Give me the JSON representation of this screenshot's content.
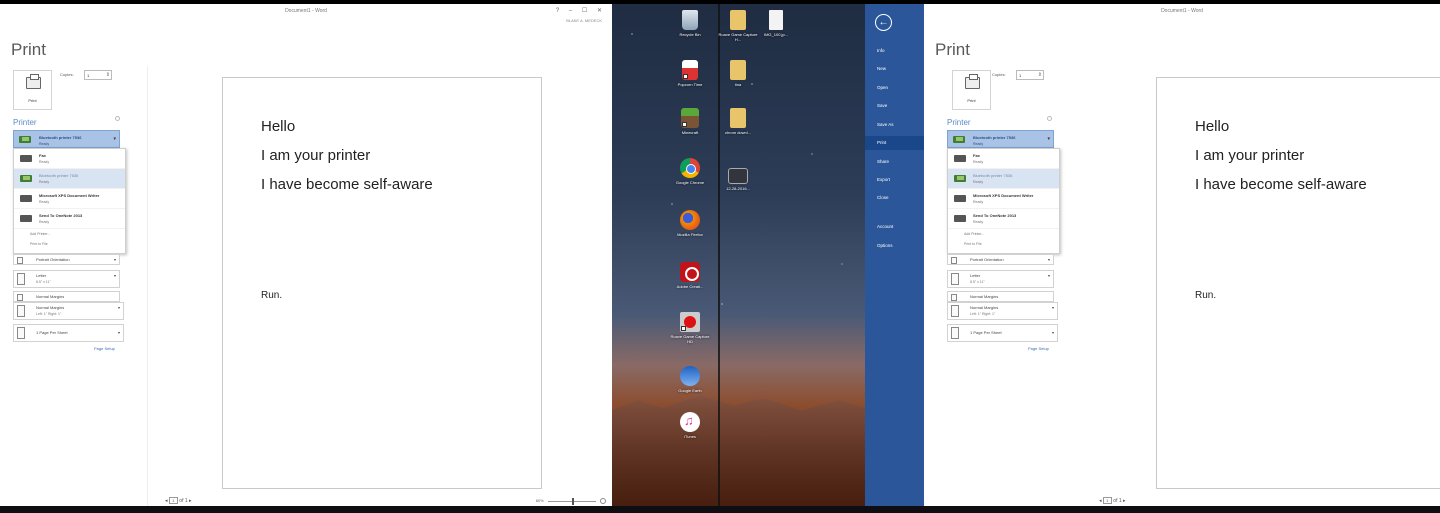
{
  "left_window": {
    "title": "Document1 - Word",
    "window_controls": "? – ☐ ✕",
    "user": "BLAKE A. MEDECK",
    "heading": "Print",
    "print_label": "Print",
    "copies_label": "Copies:",
    "copies_value": "1",
    "printer_heading": "Printer",
    "selected_printer": {
      "name": "Bluetooth printer 7536",
      "status": "Ready"
    },
    "printers": [
      {
        "name": "Fax",
        "status": "Ready",
        "icon": "fax-icon"
      },
      {
        "name": "Bluetooth printer 7536",
        "status": "Ready",
        "icon": "bluetooth-printer-icon"
      },
      {
        "name": "Microsoft XPS Document Writer",
        "status": "Ready",
        "icon": "printer-icon"
      },
      {
        "name": "Send To OneNote 2013",
        "status": "Ready",
        "icon": "printer-icon"
      }
    ],
    "add_printer": "Add Printer...",
    "print_to_file": "Print to File",
    "settings": {
      "orientation": "Portrait Orientation",
      "paper": "Letter",
      "paper_size": "8.5\" x 11\"",
      "margins_short": "Normal Margins",
      "margins": "Normal Margins",
      "margins_detail": "Left: 1\"   Right: 1\"",
      "pages_per_sheet": "1 Page Per Sheet"
    },
    "page_setup": "Page Setup",
    "page_nav": {
      "prev": "◂",
      "current": "1",
      "of": "of 1",
      "next": "▸"
    },
    "zoom": "80%"
  },
  "document": {
    "lines": [
      "Hello",
      "I am your printer",
      "I have become self-aware"
    ],
    "footer_line": "Run."
  },
  "desktop": {
    "icons": [
      {
        "label": "Recycle Bin"
      },
      {
        "label": "Roave Game Capture H..."
      },
      {
        "label": "IMG_100.jp..."
      },
      {
        "label": "Popcorn Time"
      },
      {
        "label": "tina"
      },
      {
        "label": "Minecraft"
      },
      {
        "label": "chrom downl..."
      },
      {
        "label": "Google Chrome"
      },
      {
        "label": "12-28-2016..."
      },
      {
        "label": "Mozilla Firefox"
      },
      {
        "label": "Adobe Creati..."
      },
      {
        "label": "Roave Game Capture HD"
      },
      {
        "label": "Google Earth"
      },
      {
        "label": "iTunes"
      }
    ]
  },
  "backstage": {
    "back": "←",
    "items": [
      "Info",
      "New",
      "Open",
      "Save",
      "Save As",
      "Print",
      "Share",
      "Export",
      "Close",
      "Account",
      "Options"
    ],
    "active": "Print"
  },
  "right_window": {
    "title": "Document1 - Word",
    "heading": "Print",
    "print_label": "Print",
    "copies_label": "Copies:",
    "copies_value": "1",
    "printer_heading": "Printer",
    "selected_printer": {
      "name": "Bluetooth printer 7536",
      "status": "Ready"
    },
    "printers": [
      {
        "name": "Fax",
        "status": "Ready"
      },
      {
        "name": "Bluetooth printer 7536",
        "status": "Ready"
      },
      {
        "name": "Microsoft XPS Document Writer",
        "status": "Ready"
      },
      {
        "name": "Send To OneNote 2013",
        "status": "Ready"
      }
    ],
    "add_printer": "Add Printer...",
    "print_to_file": "Print to File",
    "settings": {
      "orientation": "Portrait Orientation",
      "paper": "Letter",
      "paper_size": "8.5\" x 11\"",
      "margins_short": "Normal Margins",
      "margins": "Normal Margins",
      "margins_detail": "Left: 1\"   Right: 1\"",
      "pages_per_sheet": "1 Page Per Sheet"
    },
    "page_setup": "Page Setup",
    "page_nav": {
      "prev": "◂",
      "current": "1",
      "of": "of 1",
      "next": "▸"
    }
  },
  "colors": {
    "word_blue": "#2b579a",
    "printer_highlight": "#a9c3e6",
    "link_blue": "#3e6ab3"
  }
}
